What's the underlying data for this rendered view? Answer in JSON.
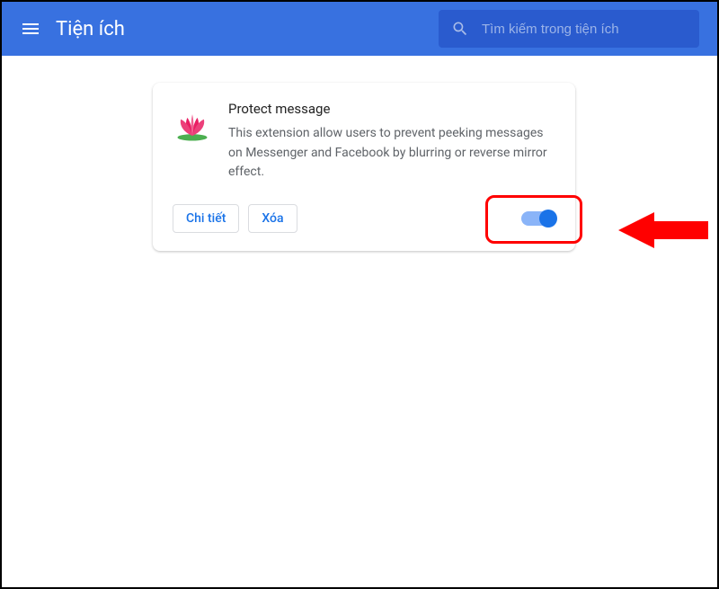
{
  "header": {
    "title": "Tiện ích"
  },
  "search": {
    "placeholder": "Tìm kiếm trong tiện ích",
    "value": ""
  },
  "extension": {
    "name": "Protect message",
    "description": "This extension allow users to prevent peeking messages on Messenger and Facebook by blurring or reverse mirror effect.",
    "details_label": "Chi tiết",
    "remove_label": "Xóa",
    "enabled": true
  }
}
